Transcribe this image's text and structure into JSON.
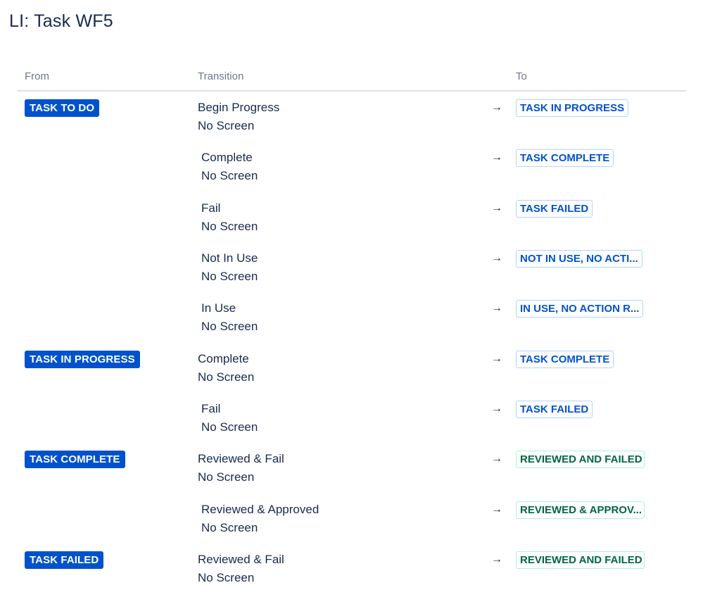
{
  "title": "LI: Task WF5",
  "headers": {
    "from": "From",
    "transition": "Transition",
    "to": "To"
  },
  "arrow_glyph": "→",
  "colors": {
    "from_bg": "#0052cc",
    "to_blue": "#0052cc",
    "to_green": "#006644"
  },
  "rows": [
    {
      "from": "TASK TO DO",
      "transition": "Begin Progress",
      "screen": "No Screen",
      "to": "TASK IN PROGRESS",
      "to_color": "blue"
    },
    {
      "from": "",
      "transition": "Complete",
      "screen": "No Screen",
      "to": "TASK COMPLETE",
      "to_color": "blue"
    },
    {
      "from": "",
      "transition": "Fail",
      "screen": "No Screen",
      "to": "TASK FAILED",
      "to_color": "blue"
    },
    {
      "from": "",
      "transition": "Not In Use",
      "screen": "No Screen",
      "to": "NOT IN USE, NO ACTI...",
      "to_color": "blue"
    },
    {
      "from": "",
      "transition": "In Use",
      "screen": "No Screen",
      "to": "IN USE, NO ACTION R...",
      "to_color": "blue"
    },
    {
      "from": "TASK IN PROGRESS",
      "transition": "Complete",
      "screen": "No Screen",
      "to": "TASK COMPLETE",
      "to_color": "blue"
    },
    {
      "from": "",
      "transition": "Fail",
      "screen": "No Screen",
      "to": "TASK FAILED",
      "to_color": "blue"
    },
    {
      "from": "TASK COMPLETE",
      "transition": "Reviewed & Fail",
      "screen": "No Screen",
      "to": "REVIEWED AND FAILED",
      "to_color": "green"
    },
    {
      "from": "",
      "transition": "Reviewed & Approved",
      "screen": "No Screen",
      "to": "REVIEWED & APPROV...",
      "to_color": "green"
    },
    {
      "from": "TASK FAILED",
      "transition": "Reviewed & Fail",
      "screen": "No Screen",
      "to": "REVIEWED AND FAILED",
      "to_color": "green"
    }
  ]
}
